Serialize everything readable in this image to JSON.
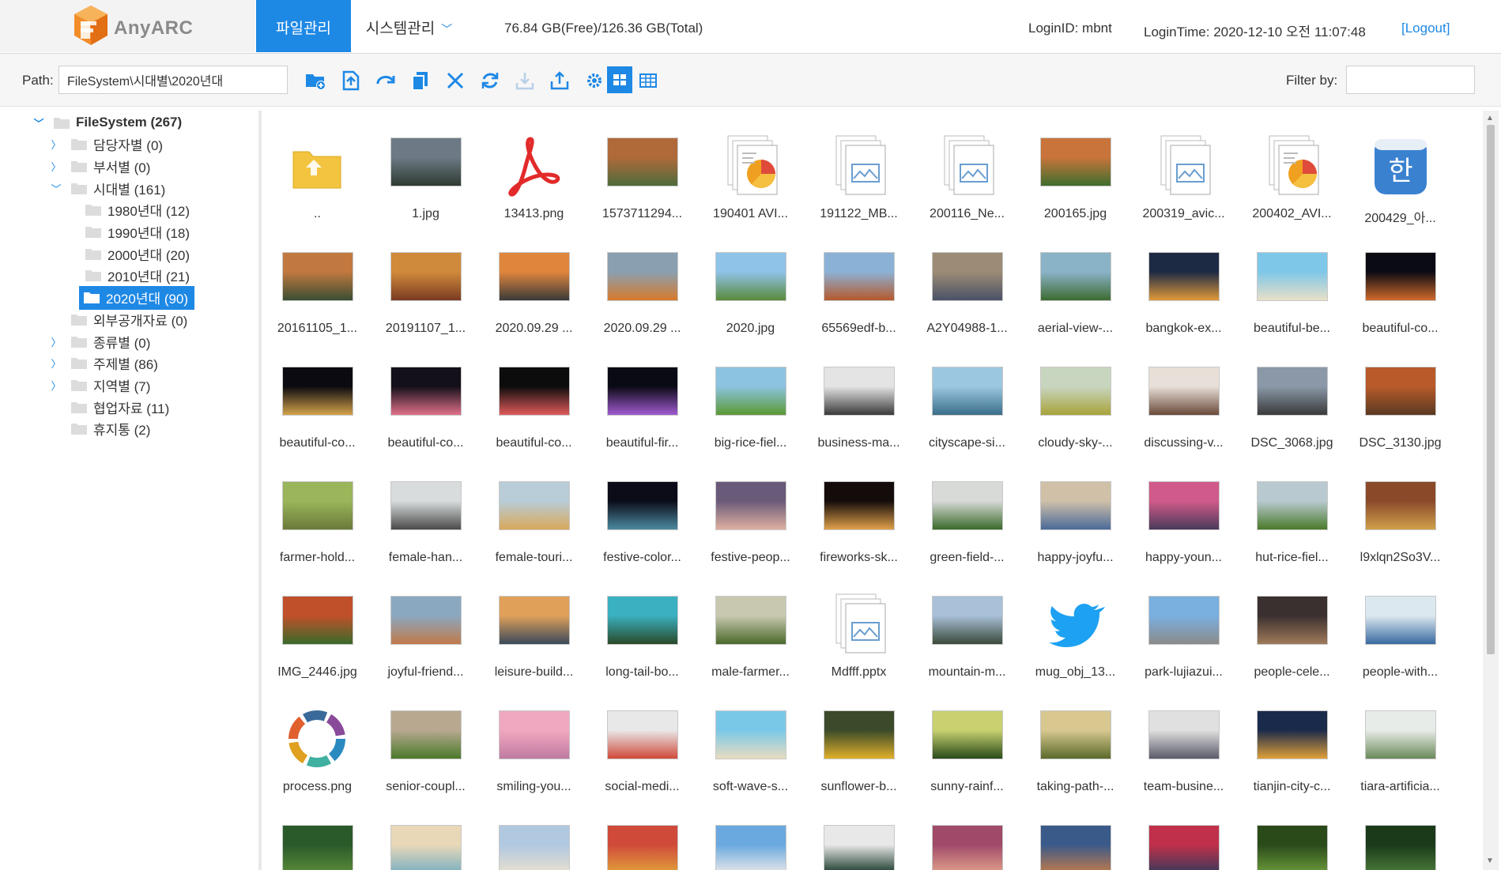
{
  "header": {
    "logo_text": "AnyARC",
    "tab_file": "파일관리",
    "tab_system": "시스템관리",
    "storage": "76.84 GB(Free)/126.36 GB(Total)",
    "login_id": "LoginID: mbnt",
    "login_time": "LoginTime: 2020-12-10 오전 11:07:48",
    "logout": "[Logout]"
  },
  "toolbar": {
    "path_label": "Path:",
    "path_value": "FileSystem\\시대별\\2020년대",
    "filter_label": "Filter by:",
    "filter_value": "",
    "buttons": [
      "new-folder",
      "upload",
      "move",
      "copy",
      "delete",
      "refresh",
      "download",
      "share",
      "settings",
      "thumbnail-view",
      "list-view"
    ]
  },
  "tree": [
    {
      "label": "FileSystem (267)",
      "level": 0,
      "expanded": true,
      "arrow": "expanded"
    },
    {
      "label": "담당자별 (0)",
      "level": 1,
      "arrow": "collapsed"
    },
    {
      "label": "부서별 (0)",
      "level": 1,
      "arrow": "collapsed"
    },
    {
      "label": "시대별 (161)",
      "level": 1,
      "arrow": "expanded"
    },
    {
      "label": "1980년대 (12)",
      "level": 2,
      "arrow": "none"
    },
    {
      "label": "1990년대 (18)",
      "level": 2,
      "arrow": "none"
    },
    {
      "label": "2000년대 (20)",
      "level": 2,
      "arrow": "none"
    },
    {
      "label": "2010년대 (21)",
      "level": 2,
      "arrow": "none"
    },
    {
      "label": "2020년대 (90)",
      "level": 2,
      "arrow": "none",
      "selected": true
    },
    {
      "label": "외부공개자료 (0)",
      "level": 1,
      "arrow": "none"
    },
    {
      "label": "종류별 (0)",
      "level": 1,
      "arrow": "collapsed"
    },
    {
      "label": "주제별 (86)",
      "level": 1,
      "arrow": "collapsed"
    },
    {
      "label": "지역별 (7)",
      "level": 1,
      "arrow": "collapsed"
    },
    {
      "label": "협업자료 (11)",
      "level": 1,
      "arrow": "none"
    },
    {
      "label": "휴지통 (2)",
      "level": 1,
      "arrow": "none"
    }
  ],
  "files": [
    {
      "name": "..",
      "kind": "parent"
    },
    {
      "name": "1.jpg",
      "kind": "image",
      "c1": "#6d7a86",
      "c2": "#2e3a30"
    },
    {
      "name": "13413.png",
      "kind": "pdf"
    },
    {
      "name": "1573711294...",
      "kind": "image",
      "c1": "#b06a3a",
      "c2": "#4e6b3b"
    },
    {
      "name": "190401 AVI...",
      "kind": "chartdoc"
    },
    {
      "name": "191122_MB...",
      "kind": "doc"
    },
    {
      "name": "200116_Ne...",
      "kind": "doc"
    },
    {
      "name": "200165.jpg",
      "kind": "image",
      "c1": "#c8743a",
      "c2": "#3f6e2e"
    },
    {
      "name": "200319_avic...",
      "kind": "doc"
    },
    {
      "name": "200402_AVI...",
      "kind": "chartdoc"
    },
    {
      "name": "200429_아...",
      "kind": "app"
    },
    {
      "name": "20161105_1...",
      "kind": "image",
      "c1": "#c1793f",
      "c2": "#3a4d32"
    },
    {
      "name": "20191107_1...",
      "kind": "image",
      "c1": "#d08a3c",
      "c2": "#7a3b22"
    },
    {
      "name": "2020.09.29 ...",
      "kind": "image",
      "c1": "#e0853c",
      "c2": "#3a3a3a"
    },
    {
      "name": "2020.09.29 ...",
      "kind": "image",
      "c1": "#8aa0b0",
      "c2": "#d87a2c"
    },
    {
      "name": "2020.jpg",
      "kind": "image",
      "c1": "#8fc3e8",
      "c2": "#5a8a3a"
    },
    {
      "name": "65569edf-b...",
      "kind": "image",
      "c1": "#8cb1d6",
      "c2": "#b5592c"
    },
    {
      "name": "A2Y04988-1...",
      "kind": "image",
      "c1": "#9c8b75",
      "c2": "#4a5266"
    },
    {
      "name": "aerial-view-...",
      "kind": "image",
      "c1": "#8ab3c8",
      "c2": "#3d6b32"
    },
    {
      "name": "bangkok-ex...",
      "kind": "image",
      "c1": "#1d2a44",
      "c2": "#e09a3a"
    },
    {
      "name": "beautiful-be...",
      "kind": "image",
      "c1": "#7fc7e8",
      "c2": "#e8e0c8"
    },
    {
      "name": "beautiful-co...",
      "kind": "image",
      "c1": "#0b0b14",
      "c2": "#d06a2a"
    },
    {
      "name": "beautiful-co...",
      "kind": "image",
      "c1": "#0a0a10",
      "c2": "#d4a24a"
    },
    {
      "name": "beautiful-co...",
      "kind": "image",
      "c1": "#14101a",
      "c2": "#e0708a"
    },
    {
      "name": "beautiful-co...",
      "kind": "image",
      "c1": "#0c0c0c",
      "c2": "#e05a5a"
    },
    {
      "name": "beautiful-fir...",
      "kind": "image",
      "c1": "#0a0a14",
      "c2": "#a05ad0"
    },
    {
      "name": "big-rice-fiel...",
      "kind": "image",
      "c1": "#8cc3e0",
      "c2": "#5b9a35"
    },
    {
      "name": "business-ma...",
      "kind": "image",
      "c1": "#e4e4e4",
      "c2": "#3a3a3a"
    },
    {
      "name": "cityscape-si...",
      "kind": "image",
      "c1": "#9cc7e0",
      "c2": "#3a6e8a"
    },
    {
      "name": "cloudy-sky-...",
      "kind": "image",
      "c1": "#c8d6c0",
      "c2": "#a8a33a"
    },
    {
      "name": "discussing-v...",
      "kind": "image",
      "c1": "#e8e0d8",
      "c2": "#6a4a3a"
    },
    {
      "name": "DSC_3068.jpg",
      "kind": "image",
      "c1": "#8a98a8",
      "c2": "#3a3a3a"
    },
    {
      "name": "DSC_3130.jpg",
      "kind": "image",
      "c1": "#b85a2a",
      "c2": "#5a3a22"
    },
    {
      "name": "farmer-hold...",
      "kind": "image",
      "c1": "#9ab55a",
      "c2": "#6a7a3a"
    },
    {
      "name": "female-han...",
      "kind": "image",
      "c1": "#d8dcdc",
      "c2": "#4a4a4a"
    },
    {
      "name": "female-touri...",
      "kind": "image",
      "c1": "#b8cdd8",
      "c2": "#d8a85a"
    },
    {
      "name": "festive-color...",
      "kind": "image",
      "c1": "#0c0c18",
      "c2": "#4a8aa0"
    },
    {
      "name": "festive-peop...",
      "kind": "image",
      "c1": "#6a5a7a",
      "c2": "#e0b0a0"
    },
    {
      "name": "fireworks-sk...",
      "kind": "image",
      "c1": "#140c0a",
      "c2": "#e0a04a"
    },
    {
      "name": "green-field-...",
      "kind": "image",
      "c1": "#d8dad8",
      "c2": "#3a6a2a"
    },
    {
      "name": "happy-joyfu...",
      "kind": "image",
      "c1": "#d0c0a8",
      "c2": "#4a6a9a"
    },
    {
      "name": "happy-youn...",
      "kind": "image",
      "c1": "#d05a8a",
      "c2": "#4a3a5a"
    },
    {
      "name": "hut-rice-fiel...",
      "kind": "image",
      "c1": "#b8cad0",
      "c2": "#4a7a2a"
    },
    {
      "name": "l9xlqn2So3V...",
      "kind": "image",
      "c1": "#8a4a2a",
      "c2": "#d0a04a"
    },
    {
      "name": "IMG_2446.jpg",
      "kind": "image",
      "c1": "#c0502a",
      "c2": "#3a6a2a"
    },
    {
      "name": "joyful-friend...",
      "kind": "image",
      "c1": "#8aa8c0",
      "c2": "#c07a4a"
    },
    {
      "name": "leisure-build...",
      "kind": "image",
      "c1": "#e0a05a",
      "c2": "#3a4a5a"
    },
    {
      "name": "long-tail-bo...",
      "kind": "image",
      "c1": "#3ab0c0",
      "c2": "#2a4a2a"
    },
    {
      "name": "male-farmer...",
      "kind": "image",
      "c1": "#c8c8b0",
      "c2": "#4a6a2a"
    },
    {
      "name": "Mdfff.pptx",
      "kind": "doc"
    },
    {
      "name": "mountain-m...",
      "kind": "image",
      "c1": "#a8c0d8",
      "c2": "#3a4a3a"
    },
    {
      "name": "mug_obj_13...",
      "kind": "twitter"
    },
    {
      "name": "park-lujiazui...",
      "kind": "image",
      "c1": "#7ab0e0",
      "c2": "#8a8a8a"
    },
    {
      "name": "people-cele...",
      "kind": "image",
      "c1": "#3a3030",
      "c2": "#a07a5a"
    },
    {
      "name": "people-with...",
      "kind": "image",
      "c1": "#dce8f0",
      "c2": "#3a6aa0"
    },
    {
      "name": "process.png",
      "kind": "process"
    },
    {
      "name": "senior-coupl...",
      "kind": "image",
      "c1": "#b8a890",
      "c2": "#4a7a2a"
    },
    {
      "name": "smiling-you...",
      "kind": "image",
      "c1": "#f0a8c0",
      "c2": "#c07aa0"
    },
    {
      "name": "social-medi...",
      "kind": "image",
      "c1": "#e8e8e8",
      "c2": "#d04a3a"
    },
    {
      "name": "soft-wave-s...",
      "kind": "image",
      "c1": "#7ac8e8",
      "c2": "#e8dcc0"
    },
    {
      "name": "sunflower-b...",
      "kind": "image",
      "c1": "#3a4a2a",
      "c2": "#e0b02a"
    },
    {
      "name": "sunny-rainf...",
      "kind": "image",
      "c1": "#c8d070",
      "c2": "#2a4a1a"
    },
    {
      "name": "taking-path-...",
      "kind": "image",
      "c1": "#d8c890",
      "c2": "#5a6a2a"
    },
    {
      "name": "team-busine...",
      "kind": "image",
      "c1": "#e0e0e0",
      "c2": "#5a5a6a"
    },
    {
      "name": "tianjin-city-c...",
      "kind": "image",
      "c1": "#1a2a4a",
      "c2": "#e0a03a"
    },
    {
      "name": "tiara-artificia...",
      "kind": "image",
      "c1": "#e8ece8",
      "c2": "#6a8a5a"
    },
    {
      "name": "",
      "kind": "image",
      "c1": "#2a5a2a",
      "c2": "#5a8a3a"
    },
    {
      "name": "",
      "kind": "image",
      "c1": "#e8d8b8",
      "c2": "#7ab0c0"
    },
    {
      "name": "",
      "kind": "image",
      "c1": "#b0c8e0",
      "c2": "#e8e0d0"
    },
    {
      "name": "",
      "kind": "image",
      "c1": "#d04a3a",
      "c2": "#e0a03a"
    },
    {
      "name": "",
      "kind": "image",
      "c1": "#6aa8e0",
      "c2": "#e8e8e8"
    },
    {
      "name": "",
      "kind": "image",
      "c1": "#e8e8e8",
      "c2": "#1a3a2a"
    },
    {
      "name": "",
      "kind": "image",
      "c1": "#a04a6a",
      "c2": "#e0a08a"
    },
    {
      "name": "",
      "kind": "image",
      "c1": "#3a5a8a",
      "c2": "#c07a4a"
    },
    {
      "name": "",
      "kind": "image",
      "c1": "#c0304a",
      "c2": "#3a3a5a"
    },
    {
      "name": "",
      "kind": "image",
      "c1": "#2a4a1a",
      "c2": "#6a9a3a"
    },
    {
      "name": "",
      "kind": "image",
      "c1": "#1a3a1a",
      "c2": "#4a7a3a"
    }
  ],
  "colors": {
    "accent": "#1e88e5",
    "folder": "#f3c43f"
  }
}
